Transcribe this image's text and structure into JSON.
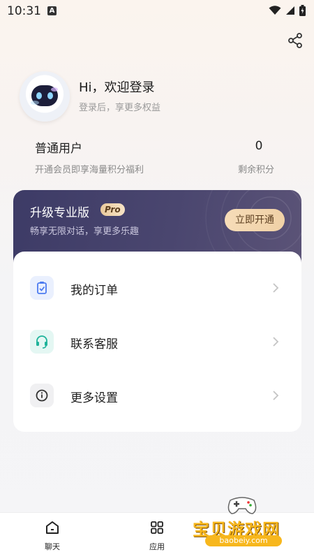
{
  "status_bar": {
    "time": "10:31",
    "notif_letter": "A"
  },
  "profile": {
    "greeting": "Hi，欢迎登录",
    "subtitle": "登录后，享更多权益"
  },
  "membership": {
    "title": "普通用户",
    "subtitle": "开通会员即享海量积分福利",
    "points_value": "0",
    "points_label": "剩余积分"
  },
  "pro_card": {
    "title": "升级专业版",
    "badge": "Pro",
    "subtitle": "畅享无限对话，享更多乐趣",
    "button": "立即开通"
  },
  "menu": [
    {
      "label": "我的订单",
      "icon": "clipboard-check-icon",
      "color": "#4c7bf0",
      "bg": "#eaf0fe"
    },
    {
      "label": "联系客服",
      "icon": "headset-icon",
      "color": "#1fb39a",
      "bg": "#e4f7f3"
    },
    {
      "label": "更多设置",
      "icon": "info-circle-icon",
      "color": "#333333",
      "bg": "#f0f0f2"
    }
  ],
  "nav": [
    {
      "label": "聊天",
      "icon": "home-icon"
    },
    {
      "label": "应用",
      "icon": "grid-icon"
    }
  ],
  "watermark": {
    "text": "宝贝游戏网",
    "url": "baobeiy.com"
  }
}
